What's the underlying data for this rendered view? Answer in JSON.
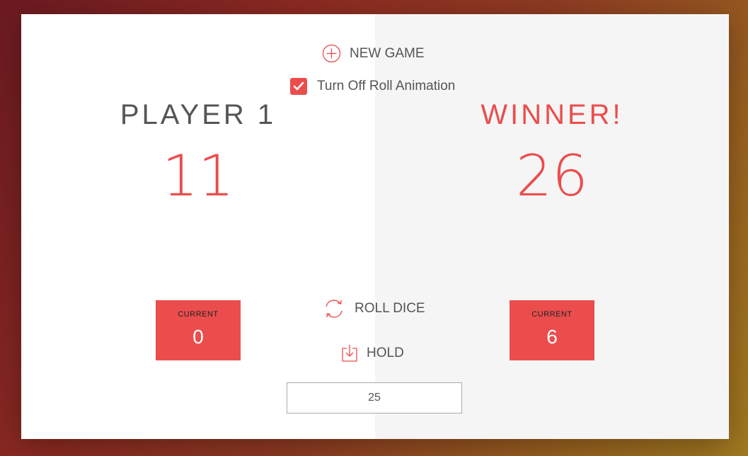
{
  "controls": {
    "new_game_label": "NEW GAME",
    "animation_toggle_label": "Turn Off Roll Animation",
    "animation_toggle_checked": true,
    "roll_dice_label": "ROLL DICE",
    "hold_label": "HOLD",
    "final_score_value": "25"
  },
  "players": [
    {
      "name": "PLAYER 1",
      "score": "11",
      "current_label": "CURRENT",
      "current_score": "0"
    },
    {
      "name": "WINNER!",
      "score": "26",
      "current_label": "CURRENT",
      "current_score": "6"
    }
  ],
  "colors": {
    "accent": "#eb4d4d",
    "text": "#555555",
    "panel_active": "#f5f5f5",
    "panel_inactive": "#ffffff"
  },
  "icons": {
    "new_game": "plus-circle-icon",
    "toggle": "checkmark-icon",
    "roll": "refresh-icon",
    "hold": "download-icon"
  }
}
